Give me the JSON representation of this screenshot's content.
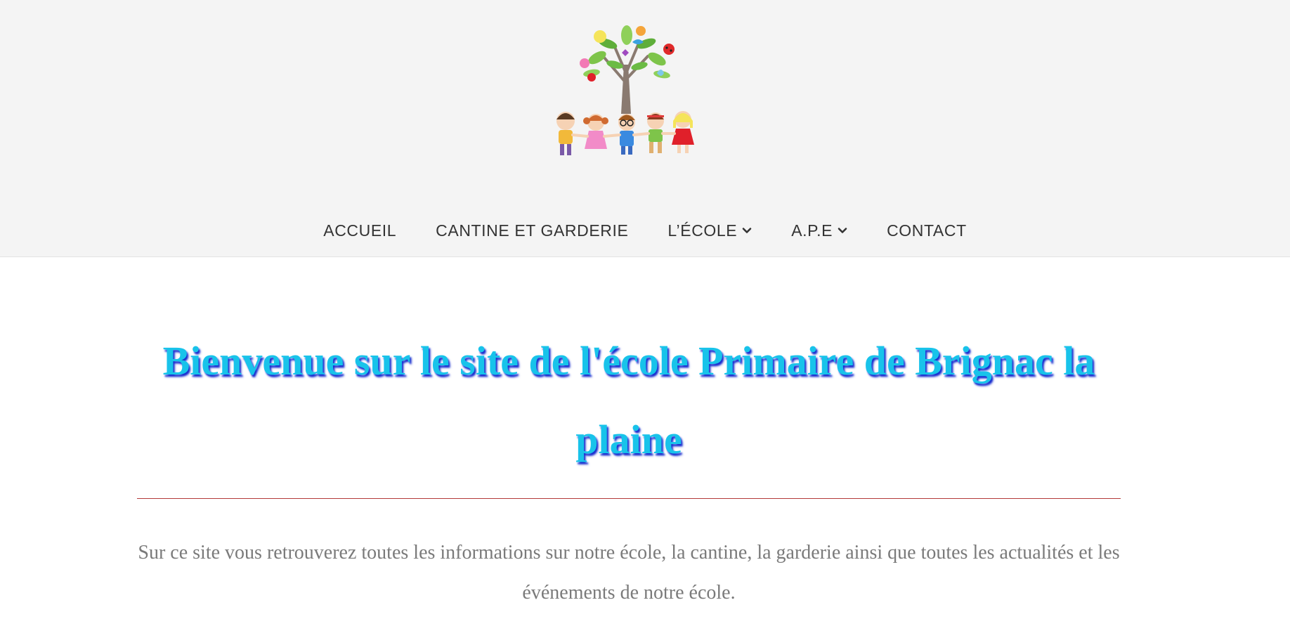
{
  "header": {
    "logo_icon": "school-tree-children-logo"
  },
  "nav": {
    "items": [
      {
        "label": "ACCUEIL",
        "has_dropdown": false
      },
      {
        "label": "CANTINE ET GARDERIE",
        "has_dropdown": false
      },
      {
        "label": "L’ÉCOLE",
        "has_dropdown": true,
        "icon": "chevron-down-icon"
      },
      {
        "label": "A.P.E",
        "has_dropdown": true,
        "icon": "chevron-down-icon"
      },
      {
        "label": "CONTACT",
        "has_dropdown": false
      }
    ]
  },
  "main": {
    "title": "Bienvenue sur le site de l'école Primaire de Brignac la plaine",
    "intro": "Sur ce site vous retrouverez toutes les informations sur notre école, la cantine, la garderie ainsi que toutes les actualités et les événements de notre école."
  },
  "colors": {
    "header_bg": "#f4f4f4",
    "title": "#18c3ea",
    "title_shadow": "#1a2fd0",
    "divider": "#b33a3a",
    "body_text": "#7a7a7a",
    "nav_text": "#333333"
  }
}
